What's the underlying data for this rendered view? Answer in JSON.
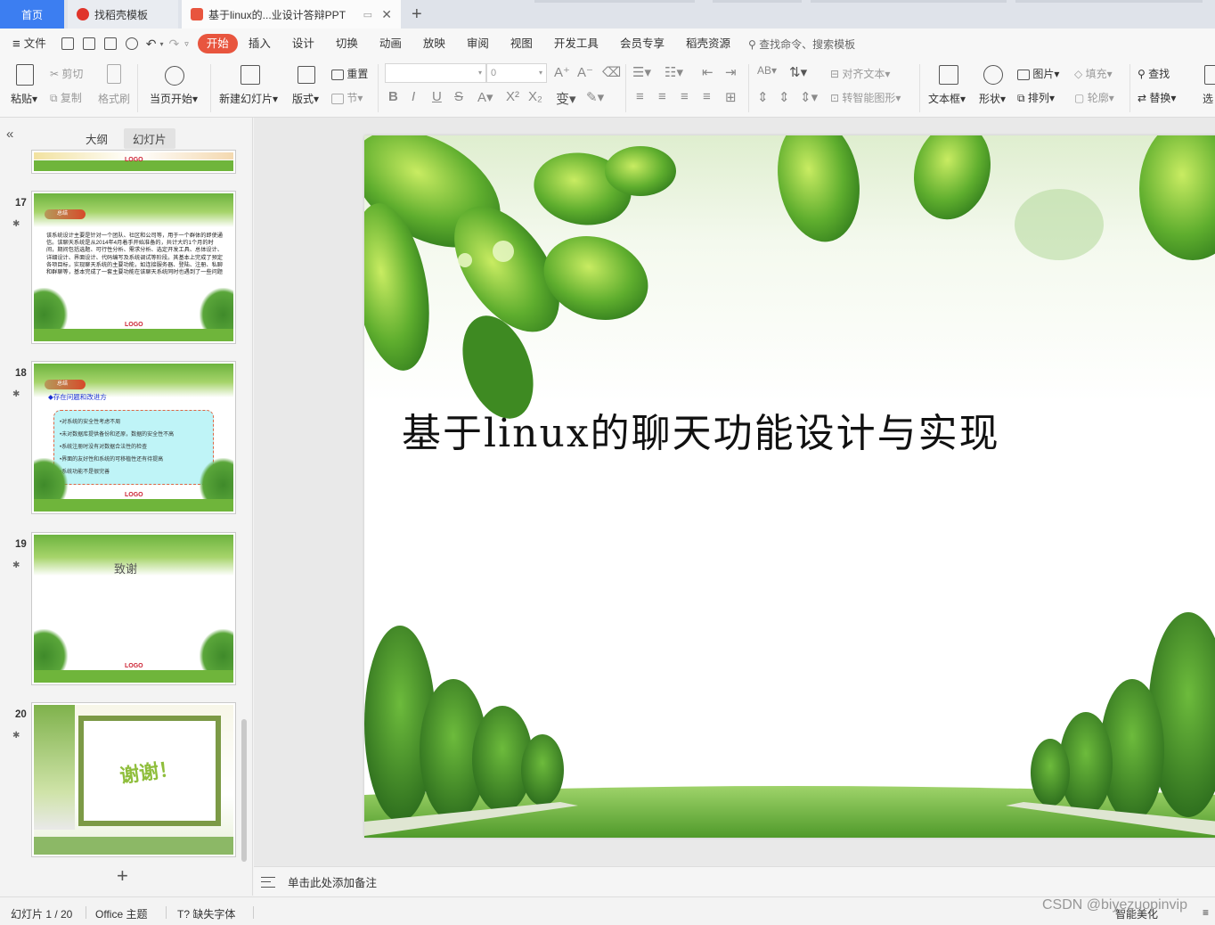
{
  "tabs": {
    "home": "首页",
    "template": "找稻壳模板",
    "document": "基于linux的...业设计答辩PPT"
  },
  "menu": {
    "file": "文件",
    "items": [
      "开始",
      "插入",
      "设计",
      "切换",
      "动画",
      "放映",
      "审阅",
      "视图",
      "开发工具",
      "会员专享",
      "稻壳资源"
    ],
    "active": "开始",
    "search": "查找命令、搜索模板"
  },
  "ribbon": {
    "paste": "粘贴",
    "cut": "剪切",
    "copy": "复制",
    "format_painter": "格式刷",
    "from_start": "当页开始",
    "new_slide": "新建幻灯片",
    "layout": "版式",
    "section": "节",
    "reset": "重置",
    "font_size": "0",
    "align_text": "对齐文本",
    "smart_shape": "转智能图形",
    "textbox": "文本框",
    "shape": "形状",
    "picture": "图片",
    "arrange": "排列",
    "fill": "填充",
    "outline": "轮廓",
    "find": "查找",
    "replace": "替换",
    "select": "选"
  },
  "leftpane": {
    "tab_outline": "大纲",
    "tab_slides": "幻灯片",
    "slides": [
      {
        "num": "17",
        "badge": "总结",
        "text": "该系统设计主要是针对一个团队、社区和公司等，用于一个群体的即使通信。该聊天系统是从2014年4月着手开始准备的，共计大约1个月的时间，期间包括选题、可行性分析、需求分析、选定开发工具、总体设计、详细设计、界面设计、代码编写及系统调试等阶段。其基本上完成了预定各项目标，实现聊天系统的主要功能，如连接服务器、登陆、注册、私聊和群聊等，基本完成了一套主要功能在该聊天系统同时也遇到了一些问题",
        "logo": "LOGO"
      },
      {
        "num": "18",
        "badge": "总结",
        "heading": "◆存在问题和改进方",
        "bullets": [
          "•对系统的安全性考虑不周",
          "•未对数据库提供备份和还原，数据的安全性不高",
          "•系统注册时没有对数据合法性的检查",
          "•界面的友好性和系统的可移植性还有待提高",
          "•系统功能不是很完善"
        ],
        "logo": "LOGO"
      },
      {
        "num": "19",
        "title": "致谢",
        "logo": "LOGO"
      },
      {
        "num": "20",
        "title": "谢谢！"
      }
    ],
    "top_logo": "LOGO"
  },
  "slide": {
    "title": "基于linux的聊天功能设计与实现"
  },
  "notes": {
    "placeholder": "单击此处添加备注"
  },
  "status": {
    "slide_count": "幻灯片 1 / 20",
    "theme": "Office 主题",
    "missing_font": "缺失字体",
    "smart_beautify": "智能美化"
  },
  "watermark": "CSDN @biyezuopinvip"
}
